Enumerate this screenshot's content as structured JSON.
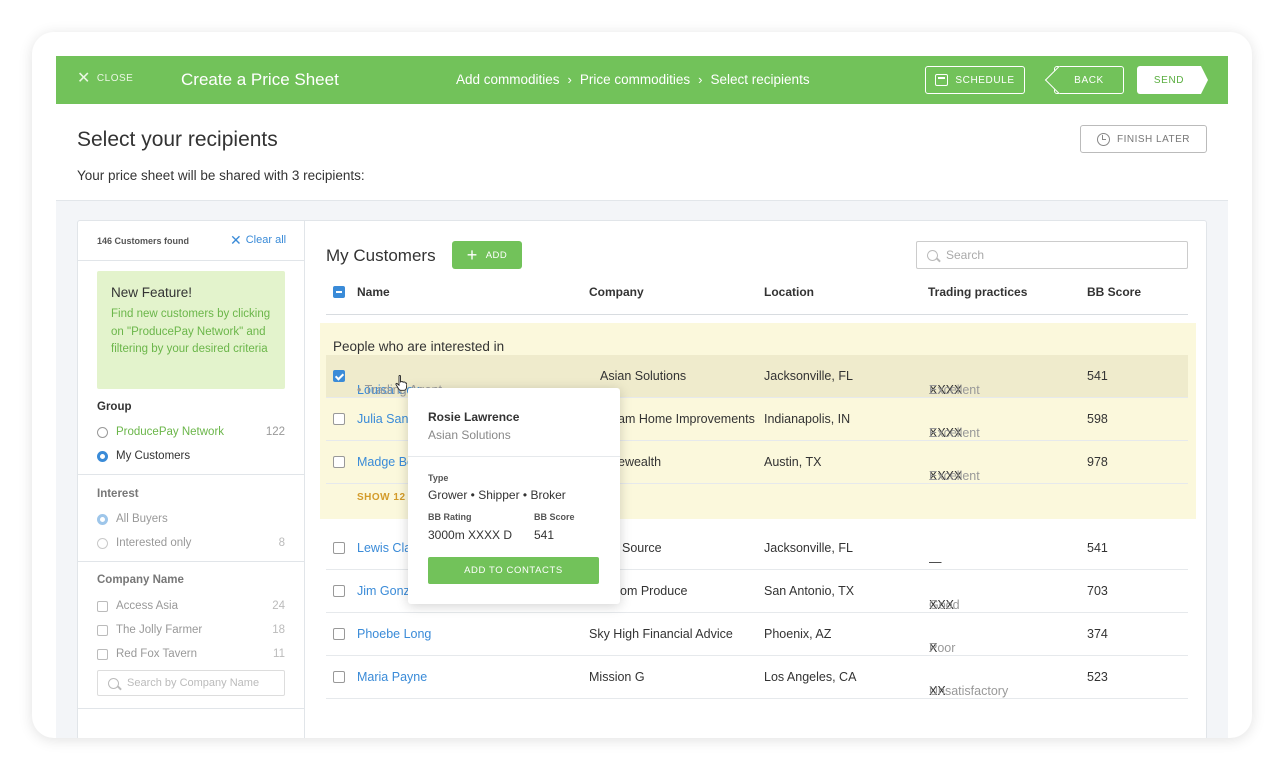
{
  "topbar": {
    "close_label": "CLOSE",
    "title": "Create a Price Sheet",
    "breadcrumbs": [
      "Add commodities",
      "Price commodities",
      "Select recipients"
    ],
    "schedule_label": "SCHEDULE",
    "back_label": "BACK",
    "send_label": "SEND",
    "accent_color": "#72c25a"
  },
  "page": {
    "title": "Select your recipients",
    "subtitle": "Your price sheet will be shared with 3 recipients:",
    "finish_later_label": "FINISH LATER"
  },
  "filters": {
    "found_label": "146 Customers found",
    "clear_all_label": "Clear all",
    "new_feature": {
      "title": "New Feature!",
      "body": "Find new customers by clicking on \"ProducePay Network\" and filtering by your desired criteria"
    },
    "group": {
      "title": "Group",
      "options": [
        {
          "label": "ProducePay Network",
          "count": "122",
          "selected": false
        },
        {
          "label": "My Customers",
          "count": "",
          "selected": true
        }
      ]
    },
    "interest": {
      "title": "Interest",
      "options": [
        {
          "label": "All Buyers",
          "count": "",
          "selected": true
        },
        {
          "label": "Interested only",
          "count": "8",
          "selected": false
        }
      ]
    },
    "company_name": {
      "title": "Company Name",
      "options": [
        {
          "label": "Access Asia",
          "count": "24"
        },
        {
          "label": "The Jolly Farmer",
          "count": "18"
        },
        {
          "label": "Red Fox Tavern",
          "count": "11"
        }
      ],
      "search_placeholder": "Search by Company Name"
    }
  },
  "main": {
    "title": "My Customers",
    "add_label": "ADD",
    "search_placeholder": "Search",
    "columns": [
      "Name",
      "Company",
      "Location",
      "Trading practices",
      "BB Score"
    ],
    "interest_title": "People who are interested in",
    "show_more_label": "SHOW 12 I",
    "rows": [
      {
        "name": "Louisa Cox",
        "role": "• Trading Agent",
        "company": "Asian Solutions",
        "location": "Jacksonville, FL",
        "rating_marks": "XXXX",
        "rating_text": "Excellent",
        "score": "541",
        "checked": true
      },
      {
        "name": "Julia Sanc",
        "role": "",
        "company": "am Home Improvements",
        "location": "Indianapolis, IN",
        "rating_marks": "XXXX",
        "rating_text": "Excellent",
        "score": "598",
        "checked": false
      },
      {
        "name": "Madge Be",
        "role": "",
        "company": "ewealth",
        "location": "Austin, TX",
        "rating_marks": "XXXX",
        "rating_text": "Excellent",
        "score": "978",
        "checked": false
      },
      {
        "name": "Lewis Cla",
        "role": "",
        "company": "Source",
        "location": "Jacksonville, FL",
        "rating_marks": "—",
        "rating_text": "",
        "score": "541",
        "checked": false
      },
      {
        "name": "Jim Gonz",
        "role": "",
        "company": "om Produce",
        "location": "San Antonio, TX",
        "rating_marks": "XXX",
        "rating_text": "Good",
        "score": "703",
        "checked": false
      },
      {
        "name": "Phoebe Long",
        "role": "",
        "company": "Sky High Financial Advice",
        "location": "Phoenix, AZ",
        "rating_marks": "X",
        "rating_text": "Poor",
        "score": "374",
        "checked": false
      },
      {
        "name": "Maria Payne",
        "role": "",
        "company": "Mission G",
        "location": "Los Angeles, CA",
        "rating_marks": "XX",
        "rating_text": "Unsatisfactory",
        "score": "523",
        "checked": false
      }
    ]
  },
  "popup": {
    "name": "Rosie Lawrence",
    "company": "Asian Solutions",
    "type_label": "Type",
    "type_value": "Grower • Shipper • Broker",
    "rating_label": "BB Rating",
    "rating_value": "3000m XXXX D",
    "score_label": "BB Score",
    "score_value": "541",
    "button_label": "ADD TO CONTACTS"
  }
}
